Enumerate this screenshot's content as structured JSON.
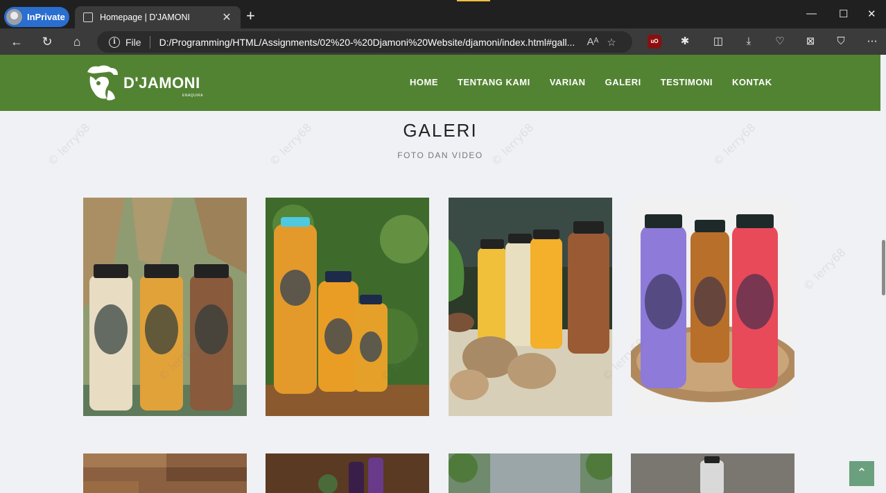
{
  "browser": {
    "inprivate_label": "InPrivate",
    "tab_title": "Homepage | D'JAMONI",
    "address_prefix": "File",
    "url": "D:/Programming/HTML/Assignments/02%20-%20Djamoni%20Website/djamoni/index.html#gall..."
  },
  "site": {
    "logo_text": "D'JAMONI",
    "logo_sub": "ENAQUIRA",
    "nav": [
      "HOME",
      "TENTANG KAMI",
      "VARIAN",
      "GALERI",
      "TESTIMONI",
      "KONTAK"
    ]
  },
  "gallery": {
    "title": "GALERI",
    "subtitle": "FOTO DAN VIDEO",
    "row1": [
      {
        "alt": "three bottles on leaves background",
        "colors": [
          "#e8dcc3",
          "#e2a23a",
          "#8a5a3c"
        ],
        "bg": "#8f9c72"
      },
      {
        "alt": "large bottle and two bottles among leaves",
        "colors": [
          "#e39a2b",
          "#ea9d24",
          "#e4a028"
        ],
        "bg": "#3e6b2c"
      },
      {
        "alt": "five bottles with ginger on burlap",
        "colors": [
          "#f0c03a",
          "#e8dfc0",
          "#f4b02a",
          "#9a5a34"
        ],
        "bg": "#2c3a2a"
      },
      {
        "alt": "three colored bottles on wood slice",
        "colors": [
          "#8e7ad8",
          "#b86f2a",
          "#e84a5a"
        ],
        "bg": "#f1f1f1"
      }
    ],
    "row2": [
      {
        "bg": "#8a6040"
      },
      {
        "bg": "#5a3a22"
      },
      {
        "bg": "#6f8a6c"
      },
      {
        "bg": "#7a7670"
      }
    ]
  },
  "watermark_text": "© lerry68"
}
